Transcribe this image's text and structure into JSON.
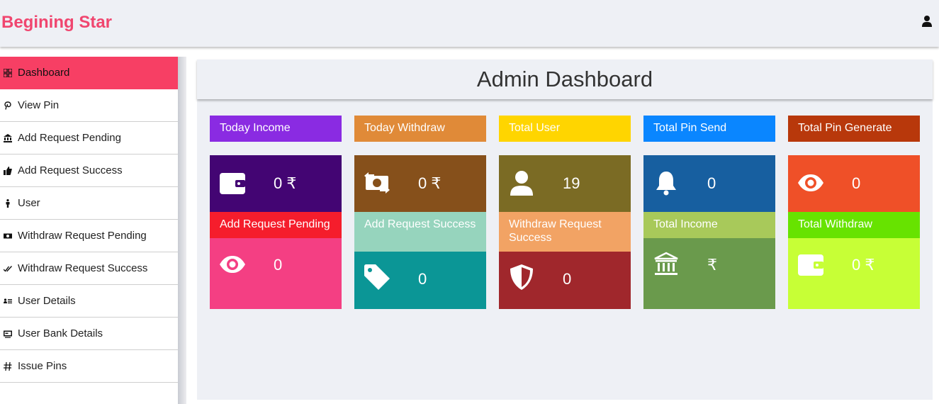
{
  "header": {
    "brand": "Begining Star"
  },
  "sidebar": {
    "items": [
      {
        "label": "Dashboard",
        "icon": "dashboard-icon"
      },
      {
        "label": "View Pin",
        "icon": "pinterest-icon"
      },
      {
        "label": "Add Request Pending",
        "icon": "bank-icon"
      },
      {
        "label": "Add Request Success",
        "icon": "thumbs-up-icon"
      },
      {
        "label": "User",
        "icon": "person-icon"
      },
      {
        "label": "Withdraw Request Pending",
        "icon": "money-icon"
      },
      {
        "label": "Withdraw Request Success",
        "icon": "double-check-icon"
      },
      {
        "label": "User Details",
        "icon": "id-list-icon"
      },
      {
        "label": "User Bank Details",
        "icon": "card-icon"
      },
      {
        "label": "Issue Pins",
        "icon": "hash-icon"
      }
    ]
  },
  "main": {
    "title": "Admin Dashboard"
  },
  "cards": [
    {
      "title": "Today Income",
      "value": "0 ₹",
      "icon": "wallet-icon",
      "head_color": "#8a2be2",
      "body_color": "#430573"
    },
    {
      "title": "Today Withdraw",
      "value": "0 ₹",
      "icon": "money-exchange-icon",
      "head_color": "#e08a38",
      "body_color": "#86501b"
    },
    {
      "title": "Total User",
      "value": "19",
      "icon": "user-icon",
      "head_color": "#ffd500",
      "body_color": "#7b6b24"
    },
    {
      "title": "Total Pin Send",
      "value": "0",
      "icon": "bell-icon",
      "head_color": "#0a86ff",
      "body_color": "#175fa0"
    },
    {
      "title": "Total Pin Generate",
      "value": "0",
      "icon": "eye-icon",
      "head_color": "#b8380b",
      "body_color": "#ef5028"
    },
    {
      "title": "Add Request Pending",
      "value": "0",
      "icon": "eye-icon",
      "head_color": "#f51d2c",
      "body_color": "#f43f83"
    },
    {
      "title": "Add Request Success",
      "value": "0",
      "icon": "tag-icon",
      "head_color": "#96d4bd",
      "body_color": "#0b9696"
    },
    {
      "title": "Withdraw Request Success",
      "value": "0",
      "icon": "shield-icon",
      "head_color": "#f2a364",
      "body_color": "#a0272c"
    },
    {
      "title": "Total Income",
      "value": "₹",
      "icon": "bank-icon",
      "head_color": "#a8c95a",
      "body_color": "#6a9a4c"
    },
    {
      "title": "Total Withdraw",
      "value": "0 ₹",
      "icon": "wallet-icon",
      "head_color": "#67e300",
      "body_color": "#c7ff36"
    }
  ]
}
